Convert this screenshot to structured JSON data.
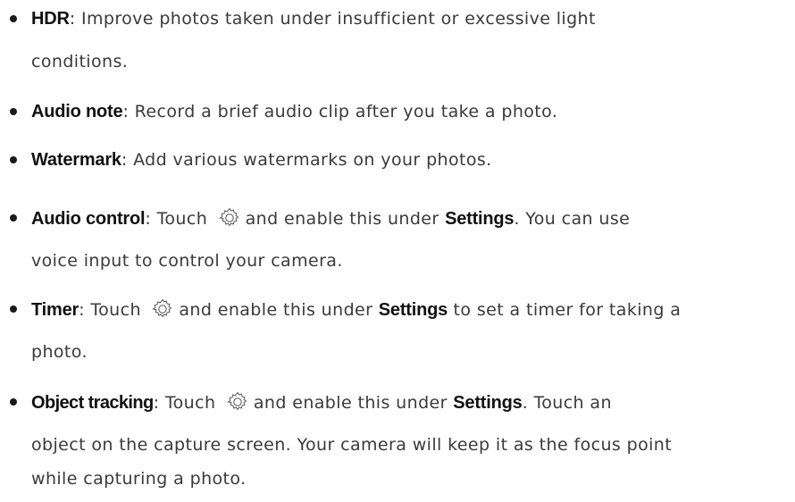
{
  "items": [
    {
      "term": "HDR",
      "line1": ": Improve photos taken under insufficient or excessive light",
      "line2": "conditions."
    },
    {
      "term": "Audio note",
      "line1": ": Record a brief audio clip after you take a photo."
    },
    {
      "term": "Watermark",
      "line1": ": Add various watermarks on your photos."
    },
    {
      "term": "Audio control",
      "pre_icon": ": Touch",
      "mid": "and enable this under",
      "settings": "Settings",
      "post": ". You can use",
      "line2": "voice input to control your camera."
    },
    {
      "term": "Timer",
      "pre_icon": ": Touch",
      "mid": "and enable this under",
      "settings": "Settings",
      "post": " to set a timer for taking a",
      "line2": "photo."
    },
    {
      "term": "Object tracking",
      "pre_icon": ": Touch",
      "mid": "and enable this under",
      "settings": "Settings",
      "post": ". Touch an",
      "line2": "object on the capture screen. Your camera will keep it as the focus point",
      "line3": "while capturing a photo."
    }
  ],
  "icons": {
    "settings": "gear-icon"
  }
}
